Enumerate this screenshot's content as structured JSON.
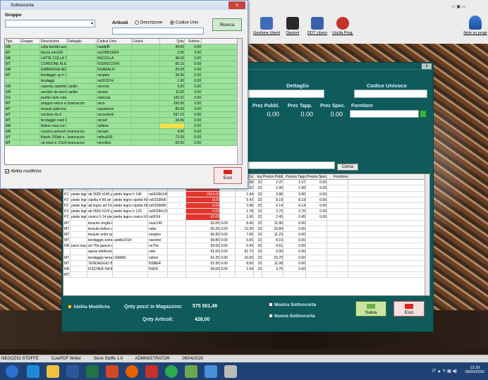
{
  "main_toolbar": {
    "buttons": [
      {
        "label": "Gestione Utenti",
        "color": "#3f6bb7"
      },
      {
        "label": "Opzioni",
        "color": "#2a2a2a"
      },
      {
        "label": "DDT Libero",
        "color": "#3b5fa8"
      },
      {
        "label": "Uscita Prog.",
        "color": "#c8302a"
      }
    ],
    "note_label": "Note su progr",
    "window_controls": "▭ ▣ ▭"
  },
  "sottoscorta": {
    "title": "Sottoscorta",
    "gruppo_label": "Gruppo",
    "articoli_label": "Articoli",
    "radio_descrizione": "Descrizione",
    "radio_codice": "Codice Univ",
    "ricerca_label": "Ricerca",
    "columns": [
      "Tipo",
      "Gruppo",
      "Descrizione",
      "Dettaglio",
      "Codice Univ.",
      "Colore",
      "Qnty",
      "Sottosc."
    ],
    "rows": [
      [
        "NR",
        "",
        "colla bordini acetovin",
        "",
        "nsadpf5",
        "",
        "44.00",
        "0.00"
      ],
      [
        "MT",
        "",
        "bocca mm160",
        "",
        "ns1068/160/4",
        "",
        "2.00",
        "0.00"
      ],
      [
        "NR",
        "",
        "LATTE COLLA THEF",
        "",
        "NSCOLLA",
        "",
        "48.00",
        "0.00"
      ],
      [
        "MT",
        "",
        "CORDONE ALETTA",
        "",
        "NS9051COF6",
        "",
        "65.15",
        "0.00"
      ],
      [
        "NR",
        "",
        "EMBRASSE AD 1 FIX",
        "",
        "NSAMALFI",
        "",
        "25.00",
        "0.00"
      ],
      [
        "MT",
        "",
        "fendaggio sp h 300",
        "",
        "nssplen",
        "",
        "34.90",
        "0.00"
      ],
      [
        "",
        "",
        "fendaggi",
        "",
        "ns00157nl",
        "",
        "1.50",
        "0.00"
      ],
      [
        "NR",
        "",
        "coperta copiletto sint",
        "canillo",
        "nsccosi",
        "",
        "3.00",
        "0.00"
      ],
      [
        "NR",
        "",
        "servizio da tavola col",
        "canillo",
        "nsceta",
        "",
        "11.00",
        "0.00"
      ],
      [
        "KG",
        "",
        "profilo niolo colore nr",
        "",
        "nsteccia",
        "",
        "120.21",
        "0.00"
      ],
      [
        "MT",
        "",
        "strappo velcro autode",
        "brancaccio",
        "nsce",
        "",
        "150.00",
        "0.00"
      ],
      [
        "MT",
        "",
        "tessuto palermo cm.2",
        "",
        "nspalermo",
        "",
        "89.90",
        "0.00"
      ],
      [
        "MT",
        "",
        "cordone da fi",
        "",
        "nscordonli",
        "",
        "597.15",
        "0.00"
      ],
      [
        "MT",
        "",
        "fendaggio nadi 100%",
        "",
        "nsnad",
        "",
        "34.95",
        "0.00"
      ],
      [
        "NR",
        "",
        "federe rosa con fiocco",
        "",
        "nsfiene",
        "",
        "",
        "0.00"
      ],
      [
        "NR",
        "",
        "cuscino pelouche tor",
        "brancaccio",
        "nscupe",
        "",
        "4.00",
        "0.00"
      ],
      [
        "NY",
        "",
        "filiacle 200pb a. 120",
        "brancaccio",
        "nsfica200",
        "",
        "72.00",
        "0.00"
      ],
      [
        "MT",
        "",
        "ud sisal nr 2110/15",
        "brancaccio",
        "nsnoilla1",
        "",
        "50.00",
        "0.00"
      ]
    ],
    "abilita_modifiche": "Abilita modifiche",
    "esci_label": "Esci"
  },
  "main_panel": {
    "labels": {
      "dettaglio": "Dettaglio",
      "codice_univoco": "Codice Univoco",
      "prez_pubbl": "Prez Pubbl.",
      "prez_tapp": "Prez Tapp.",
      "prez_spec": "Prez Spec.",
      "fornitore": "Fornitore"
    },
    "values": {
      "prez_pubbl": "0.00",
      "prez_tapp": "0.00",
      "prez_spec": "0.00"
    },
    "cerca_label": "Cerca",
    "columns": [
      "",
      "",
      "",
      "Descrizione",
      "",
      "",
      "",
      "",
      "",
      "Qnty",
      "Denota",
      "Prezzo Costo",
      "Iva",
      "Prezzo Pubb",
      "Prezzo Tapp",
      "Prezzo Spec",
      "Fornitore"
    ],
    "rows": [
      [
        "PZ",
        "piede legno",
        "piede legno conico h1",
        "piede legno conico h1",
        "ns0052",
        "",
        "-4.00",
        "",
        "1.58",
        "22",
        "2.37",
        "2.37",
        "0.00",
        ""
      ],
      [
        "PZ",
        "piede legno",
        "piede legno conico h1",
        "",
        "",
        "",
        "0.00",
        "",
        "1.32",
        "22",
        "1.96",
        "1.96",
        "0.00",
        ""
      ],
      [
        "PZ",
        "piede legno",
        "att 0026 h140 piede le",
        "piede legno h 140",
        "ns0026h140",
        "",
        "-7614.00",
        "",
        "1.94",
        "22",
        "2.86",
        "2.86",
        "0.00",
        ""
      ],
      [
        "PZ",
        "piede legno",
        "cipolla h 90 art 0153 i",
        "piede legno cipolla h90",
        "ns0153h90",
        "",
        "0.00",
        "",
        "5.42",
        "22",
        "8.19",
        "8.19",
        "0.00",
        ""
      ],
      [
        "PZ",
        "piede legno",
        "att legno art 0183 c",
        "piede legno cipolla h80",
        "ns0183h80",
        "",
        "0.00",
        "",
        "3.98",
        "22",
        "6.14",
        "6.14",
        "0.00",
        ""
      ],
      [
        "PZ",
        "piede legno",
        "att 0026 h120 piede le",
        "piede legno h 120",
        "ns0026h120",
        "",
        "0.00",
        "",
        "1.78",
        "22",
        "2.70",
        "2.70",
        "0.00",
        ""
      ],
      [
        "PZ",
        "piede legno",
        "conico h 14 piede legr",
        "piede legno conico h1",
        "ns0014",
        "",
        "-10.00",
        "",
        "1.66",
        "22",
        "2.45",
        "2.45",
        "0.00",
        ""
      ],
      [
        "MT",
        "",
        "tessuto cinglia h140",
        "",
        "nsac140",
        "",
        "62.00",
        "0.00",
        "8.40",
        "22",
        "11.80",
        "0.00",
        "",
        ""
      ],
      [
        "MT",
        "",
        "tessuto belluo crs 280",
        "",
        "nsbe",
        "",
        "56.25",
        "0.00",
        "13.30",
        "22",
        "15.84",
        "0.00",
        "",
        ""
      ],
      [
        "MT",
        "",
        "tessuto unito op",
        "",
        "nssplev",
        "",
        "56.85",
        "0.00",
        "7.60",
        "22",
        "11.23",
        "0.00",
        "",
        ""
      ],
      [
        "MT",
        "",
        "tendaggio estrel cm.3",
        "canillo2014",
        "nsestrel",
        "",
        "58.80",
        "0.00",
        "5.65",
        "22",
        "8.19",
        "0.00",
        "",
        ""
      ],
      [
        "NR",
        "pace mauizio",
        "art 70a gancio in ottone",
        "",
        "ns70a",
        "",
        "59.00",
        "0.00",
        "0.43",
        "22",
        "0.61",
        "0.00",
        "",
        ""
      ],
      [
        "",
        "",
        "spese telefoniche",
        "",
        "nste",
        "",
        "61.00",
        "0.00",
        "91.72",
        "22",
        "0.00",
        "0.00",
        "",
        ""
      ],
      [
        "MT",
        "",
        "tendaggio leman",
        "LEMAN",
        "nslem",
        "",
        "61.25",
        "0.00",
        "10.00",
        "22",
        "15.70",
        "0.00",
        "",
        ""
      ],
      [
        "MT",
        "",
        "TENDAGGIO BERMU",
        "",
        "NSBER",
        "",
        "61.95",
        "0.00",
        "8.50",
        "22",
        "11.08",
        "0.00",
        "",
        ""
      ],
      [
        "NR",
        "",
        "FISCHER DA 8 SCATI",
        "",
        "NSF8",
        "",
        "59.00",
        "0.00",
        "1.94",
        "22",
        "3.75",
        "0.00",
        "",
        ""
      ],
      [
        "MT",
        "",
        "",
        "",
        "",
        "",
        "",
        "",
        "",
        "",
        "",
        "",
        "",
        ""
      ]
    ],
    "abilita_modifiche": "Abilita Modifiche",
    "qnty_magazzino_label": "Qnty pezzi in Magazzino:",
    "qnty_magazzino_value": "575 501,48",
    "qnty_articoli_label": "Qnty Articoli:",
    "qnty_articoli_value": "428,00",
    "mostra_sottoscorta": "Mostra Sottoscorta",
    "nuova_sottoscorta": "Nuova Sottoscorta",
    "salva_label": "Salva",
    "esci_label": "Esci"
  },
  "status_bar": {
    "items": [
      "NEGOZIO STOFFE",
      "CutePDF Writer",
      "Store Stoffe 1.0",
      "ADMINISTRATOR",
      "09/04/2020"
    ]
  },
  "taskbar": {
    "clock_time": "13.29",
    "clock_date": "09/04/2020",
    "tray": "IT ▲ ✎ ▦ ◀)"
  }
}
